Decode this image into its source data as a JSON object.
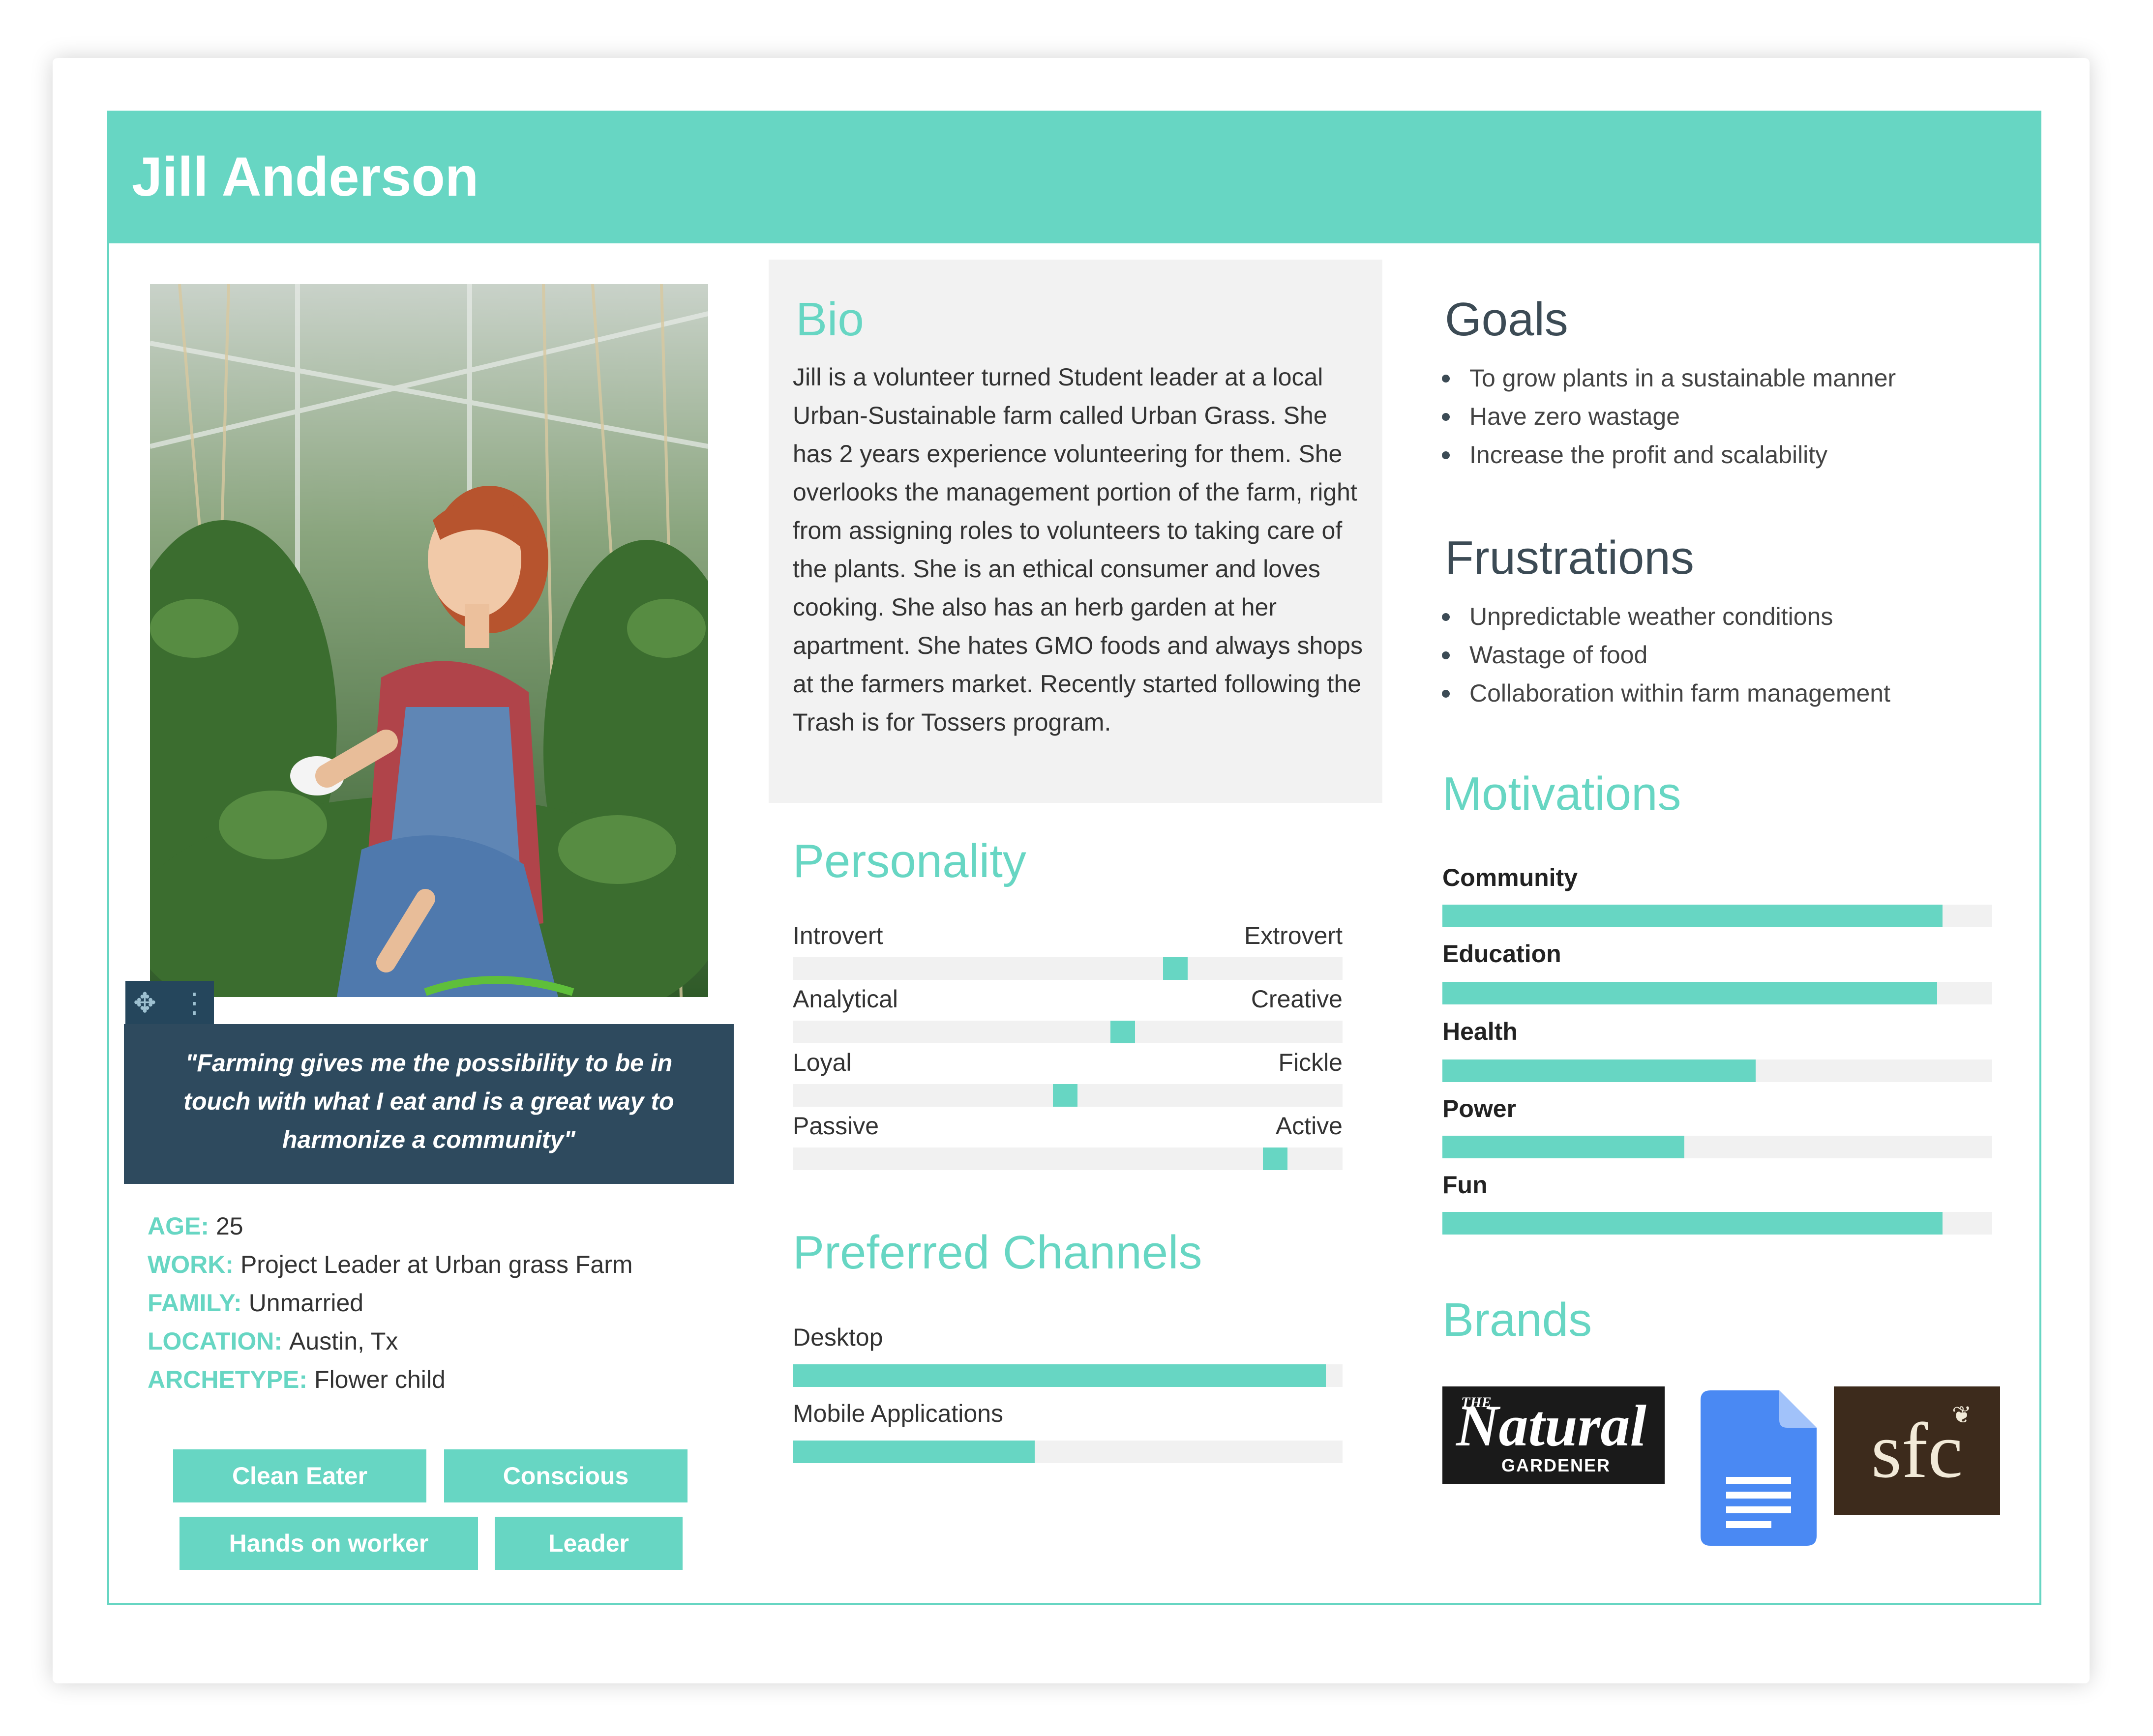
{
  "persona": {
    "name": "Jill Anderson"
  },
  "photo": {
    "alt": "Woman in overalls tending plants in a greenhouse"
  },
  "quote": "\"Farming gives me the possibility to be in touch with what I eat and is a great way to harmonize a community\"",
  "facts": [
    {
      "key": "AGE:",
      "value": "25"
    },
    {
      "key": "WORK:",
      "value": "Project Leader at Urban grass Farm"
    },
    {
      "key": "FAMILY:",
      "value": "Unmarried"
    },
    {
      "key": "LOCATION:",
      "value": "Austin, Tx"
    },
    {
      "key": "ARCHETYPE:",
      "value": "Flower child"
    }
  ],
  "tags": [
    "Clean Eater",
    "Conscious",
    "Hands on worker",
    "Leader"
  ],
  "bio": {
    "title": "Bio",
    "text": "Jill is a volunteer turned Student leader at a local Urban-Sustainable farm called Urban Grass. She has 2 years experience volunteering for them. She overlooks the management portion of the farm, right from assigning roles to volunteers to taking care of the plants. She is an ethical consumer and loves cooking. She also has an herb garden at her apartment. She hates GMO foods and always shops at the farmers market. Recently started following the Trash is for Tossers program."
  },
  "personality": {
    "title": "Personality",
    "scales": [
      {
        "left": "Introvert",
        "right": "Extrovert",
        "value": 0.705
      },
      {
        "left": "Analytical",
        "right": "Creative",
        "value": 0.605
      },
      {
        "left": "Loyal",
        "right": "Fickle",
        "value": 0.495
      },
      {
        "left": "Passive",
        "right": "Active",
        "value": 0.895
      }
    ]
  },
  "channels": {
    "title": "Preferred Channels",
    "items": [
      {
        "label": "Desktop",
        "value": 0.97
      },
      {
        "label": "Mobile Applications",
        "value": 0.44
      }
    ]
  },
  "goals": {
    "title": "Goals",
    "items": [
      "To grow plants in a sustainable manner",
      "Have zero wastage",
      "Increase the profit and scalability"
    ]
  },
  "frustrations": {
    "title": "Frustrations",
    "items": [
      "Unpredictable weather conditions",
      "Wastage of food",
      "Collaboration within farm management"
    ]
  },
  "motivations": {
    "title": "Motivations",
    "items": [
      {
        "label": "Community",
        "value": 0.91
      },
      {
        "label": "Education",
        "value": 0.9
      },
      {
        "label": "Health",
        "value": 0.57
      },
      {
        "label": "Power",
        "value": 0.44
      },
      {
        "label": "Fun",
        "value": 0.91
      }
    ]
  },
  "brands": {
    "title": "Brands",
    "items": [
      {
        "name": "The Natural Gardener",
        "top": "THE",
        "main": "Natural",
        "sub": "GARDENER"
      },
      {
        "name": "Google Docs",
        "icon": "google-docs-icon"
      },
      {
        "name": "sfc",
        "main": "sfc"
      }
    ]
  },
  "colors": {
    "accent": "#67d6c3",
    "quote_bg": "#2e4a5e",
    "heading_dark": "#3c4b55",
    "track": "#f1f1f1"
  }
}
